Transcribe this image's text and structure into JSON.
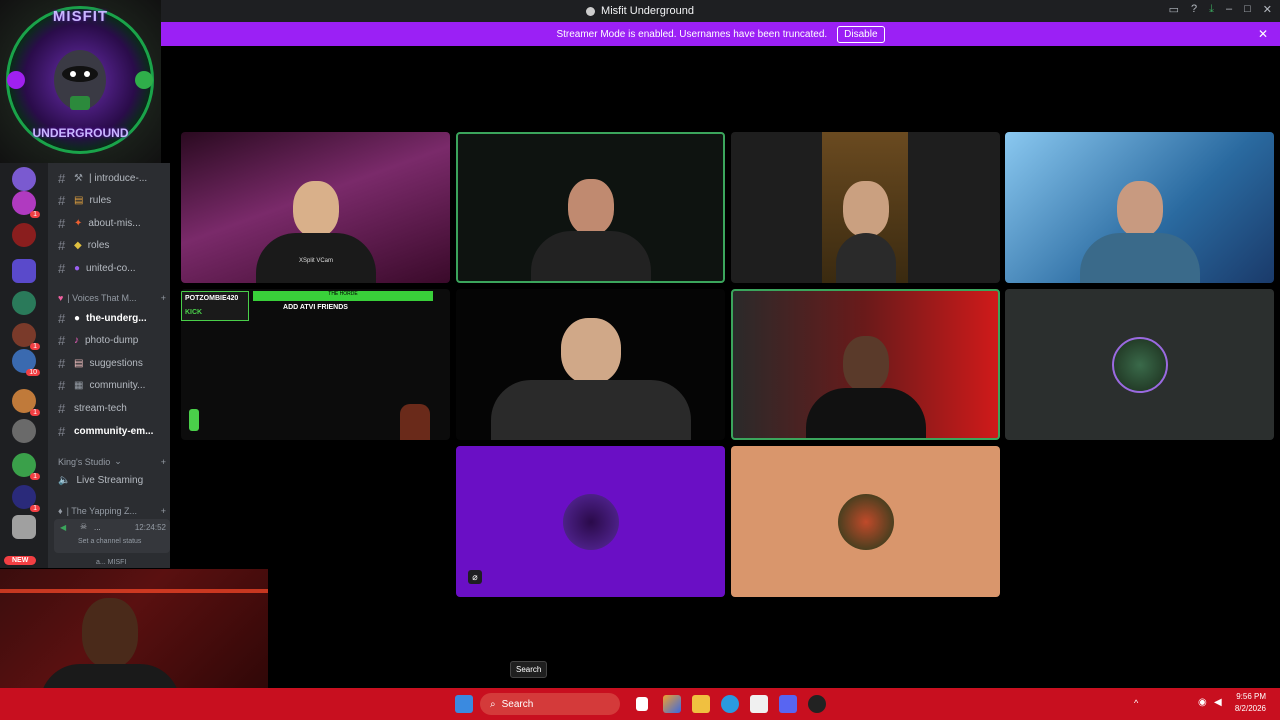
{
  "window": {
    "title": "Misfit Underground"
  },
  "banner": {
    "text": "Streamer Mode is enabled. Usernames have been truncated.",
    "disable_label": "Disable",
    "close_glyph": "✕"
  },
  "logo": {
    "line1": "MISFIT",
    "line2": "UNDERGROUND"
  },
  "channels": {
    "items": [
      {
        "label": "| introduce-..."
      },
      {
        "label": "rules"
      },
      {
        "label": "about-mis..."
      },
      {
        "label": "roles"
      },
      {
        "label": "united-co..."
      }
    ],
    "category_voices": "| Voices That M...",
    "items2": [
      {
        "label": "the-underg..."
      },
      {
        "label": "photo-dump"
      },
      {
        "label": "suggestions"
      },
      {
        "label": "community..."
      },
      {
        "label": "stream-tech"
      },
      {
        "label": "community-em..."
      }
    ],
    "category_kings": "King's Studio",
    "live_streaming": "Live Streaming",
    "category_yapping": "| The Yapping Z...",
    "voice_user": {
      "name": "...",
      "time": "12:24:52",
      "status": "Set a channel status"
    },
    "voice_user2": "a... MISFI"
  },
  "server_badges": [
    "1",
    "1",
    "10",
    "1",
    "1",
    "1"
  ],
  "new_badge": "NEW",
  "tiles": {
    "t1_overlay": "XSplit VCam",
    "t5_title": "ADD ATVI FRIENDS",
    "t5_tag": "POTZOMBIE420",
    "t5_sub": "KICK",
    "t5_banner": "THE HORDE"
  },
  "taskbar": {
    "search_label": "Search",
    "tooltip": "Search",
    "time": "9:56 PM",
    "date": "8/2/2026"
  },
  "colors": {
    "accent": "#9b20f5",
    "speaking": "#3ba55c",
    "tile_purple": "#6a0fc5",
    "tile_peach": "#d9966c"
  }
}
